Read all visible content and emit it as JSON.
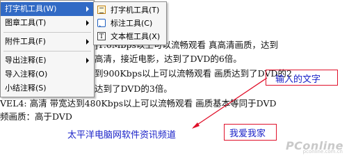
{
  "document": {
    "lines": [
      "]1.6Mbps以上可以流畅观看  真高清画质，达到",
      "高清，接近电影，达到了DVD的6倍。",
      "到900Kbps以上可以流畅观看  画质达到了DVD的2",
      "达到了DVD的3倍。",
      "VEL4: 高清  带宽达到480Kbps以上可以流畅观看  画质基本等同于DVD",
      "频画质：高于DVD"
    ],
    "blue_text": "太平洋电脑网软件资讯频道"
  },
  "annotations": {
    "callout_text": "输入的文字",
    "textbox_text": "我爱我家"
  },
  "context_menu": {
    "items": [
      {
        "label": "打字机工具(W)",
        "has_submenu": true,
        "active": true
      },
      {
        "label": "图章工具(T)",
        "has_submenu": true,
        "active": false
      },
      {
        "label": "附件工具(F)",
        "has_submenu": true,
        "active": false
      },
      {
        "label": "导出注释(E)",
        "has_submenu": true,
        "active": false
      },
      {
        "label": "导入注释(O)",
        "has_submenu": false,
        "active": false
      },
      {
        "label": "小结注释(S)",
        "has_submenu": false,
        "active": false
      }
    ]
  },
  "submenu": {
    "items": [
      {
        "label": "打字机工具(T)",
        "icon": "typewriter-icon"
      },
      {
        "label": "标注工具(C)",
        "icon": "callout-icon"
      },
      {
        "label": "文本框工具(X)",
        "icon": "textbox-icon"
      }
    ]
  },
  "watermark": {
    "brand": "PConline",
    "domain": "pconline.com.cn"
  },
  "colors": {
    "annotation_red": "#e0102a",
    "annotation_blue": "#1a22c8",
    "menu_highlight": "#316ac5"
  }
}
